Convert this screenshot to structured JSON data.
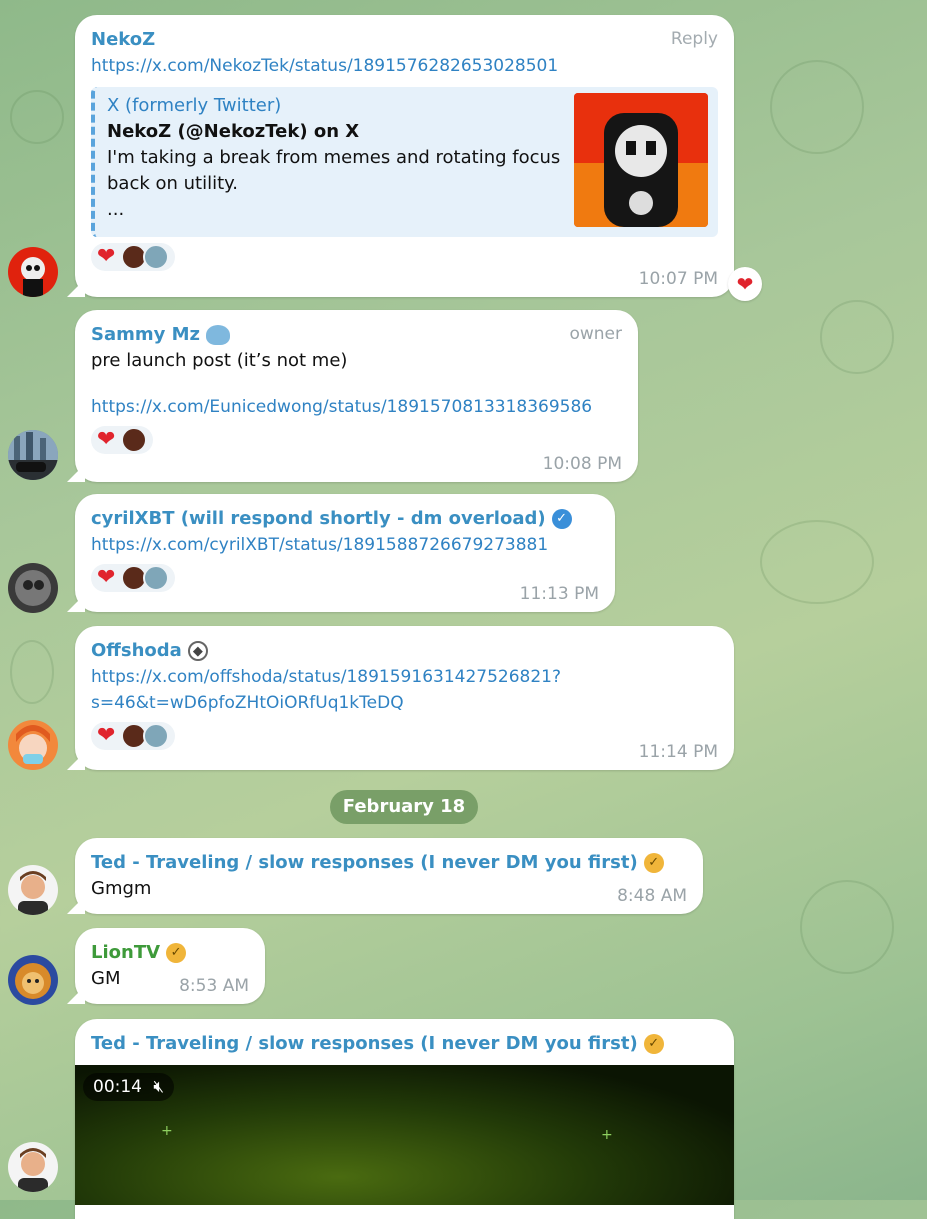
{
  "messages": {
    "m1": {
      "sender": "NekoZ",
      "action": "Reply",
      "link": "https://x.com/NekozTek/status/1891576282653028501",
      "preview": {
        "site": "X (formerly Twitter)",
        "title": "NekoZ (@NekozTek) on X",
        "description": "I'm taking a break from memes and rotating focus back on utility.",
        "ellipsis": "..."
      },
      "time": "10:07 PM"
    },
    "m2": {
      "sender": "Sammy Mz",
      "role": "owner",
      "text": "pre launch post (it’s not me)",
      "link": "https://x.com/Eunicedwong/status/1891570813318369586",
      "time": "10:08 PM"
    },
    "m3": {
      "sender": "cyrilXBT (will respond shortly - dm overload)",
      "link": "https://x.com/cyrilXBT/status/1891588726679273881",
      "time": "11:13 PM"
    },
    "m4": {
      "sender": "Offshoda",
      "link_line1": "https://x.com/offshoda/status/1891591631427526821?",
      "link_line2": "s=46&t=wD6pfoZHtOiORfUq1kTeDQ",
      "time": "11:14 PM"
    },
    "date_divider": "February 18",
    "m5": {
      "sender": "Ted - Traveling / slow responses (I never DM you first)",
      "text": "Gmgm",
      "time": "8:48 AM"
    },
    "m6": {
      "sender": "LionTV",
      "text": "GM",
      "time": "8:53 AM"
    },
    "m7": {
      "sender": "Ted - Traveling / slow responses (I never DM you first)",
      "video_time": "00:14"
    }
  },
  "colors": {
    "link": "#2f82c3",
    "sender_blue": "#3a8fc2",
    "sender_green": "#3e9a3a",
    "heart": "#e0242d"
  }
}
